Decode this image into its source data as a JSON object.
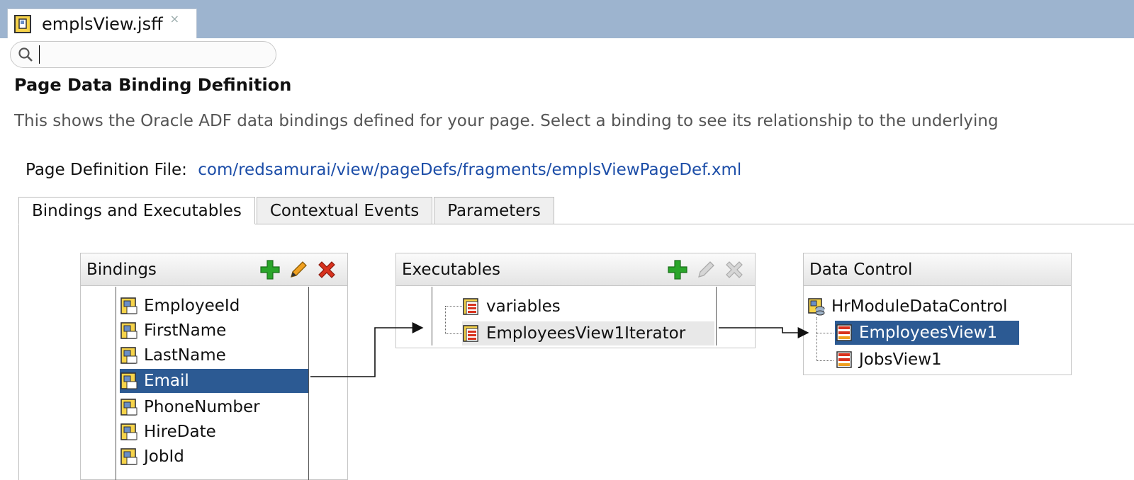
{
  "editor": {
    "tab_label": "emplsView.jsff",
    "close_glyph": "×"
  },
  "search": {
    "value": "",
    "placeholder": ""
  },
  "header": {
    "title": "Page Data Binding Definition",
    "description": "This shows the Oracle ADF data bindings defined for your page. Select a binding to see its relationship to the underlying"
  },
  "page_def": {
    "label": "Page Definition File:",
    "link": "com/redsamurai/view/pageDefs/fragments/emplsViewPageDef.xml"
  },
  "tabs": [
    {
      "label": "Bindings and Executables",
      "active": true
    },
    {
      "label": "Contextual Events",
      "active": false
    },
    {
      "label": "Parameters",
      "active": false
    }
  ],
  "bindings_panel": {
    "title": "Bindings",
    "items": [
      "EmployeeId",
      "FirstName",
      "LastName",
      "Email",
      "PhoneNumber",
      "HireDate",
      "JobId"
    ],
    "selected": "Email"
  },
  "executables_panel": {
    "title": "Executables",
    "items": [
      "variables",
      "EmployeesView1Iterator"
    ],
    "selected": "EmployeesView1Iterator"
  },
  "data_control_panel": {
    "title": "Data Control",
    "root": "HrModuleDataControl",
    "children": [
      "EmployeesView1",
      "JobsView1"
    ],
    "selected": "EmployeesView1"
  },
  "icons": {
    "add": "plus-icon",
    "edit": "pencil-icon",
    "delete": "delete-x-icon",
    "binding_item": "attribute-binding-icon",
    "iterator_item": "iterator-icon",
    "data_control": "data-control-icon",
    "collection": "collection-icon"
  },
  "colors": {
    "title_bar": "#9db4cf",
    "selection": "#2c5a93",
    "link": "#1d4ea8",
    "add_green": "#2aa52a",
    "delete_red": "#d8321e"
  }
}
